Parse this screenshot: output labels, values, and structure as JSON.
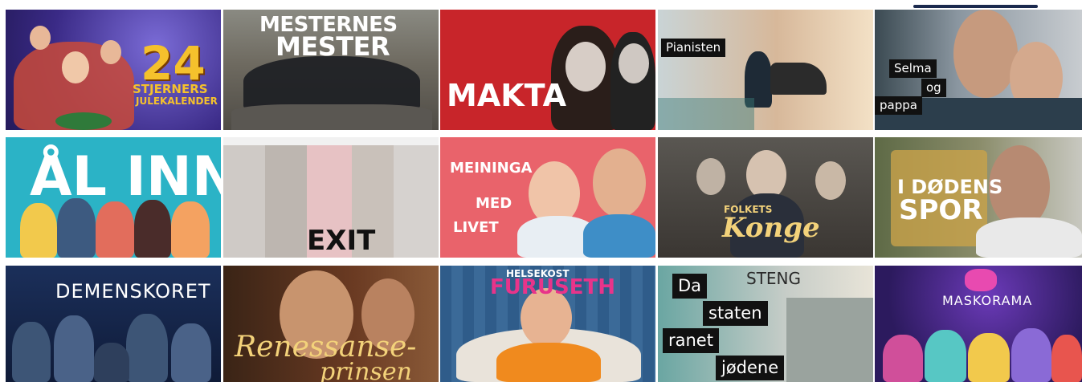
{
  "tiles": [
    {
      "id": "24-stjerners-julekalender",
      "title_main": "24",
      "title_sub1": "STJERNERS",
      "title_sub2": "JULEKALENDER"
    },
    {
      "id": "mesternes-mester",
      "line1": "MESTERNES",
      "line2": "MESTER"
    },
    {
      "id": "makta",
      "title": "MAKTA"
    },
    {
      "id": "pianisten",
      "label": "Pianisten"
    },
    {
      "id": "selma-og-pappa",
      "label1": "Selma",
      "label2": "og",
      "label3": "pappa"
    },
    {
      "id": "al-inn",
      "title": "ÅL INN"
    },
    {
      "id": "exit",
      "title": "EXIT"
    },
    {
      "id": "meininga-med-livet",
      "l1": "MEININGA",
      "l2": "MED",
      "l3": "LIVET"
    },
    {
      "id": "folkets-konge",
      "l1": "FOLKETS",
      "l2": "Konge"
    },
    {
      "id": "i-dodens-spor",
      "l1": "I DØDENS",
      "l2": "SPOR"
    },
    {
      "id": "demenskoret",
      "title": "DEMENSKORET"
    },
    {
      "id": "renessanseprinsen",
      "l1": "Renessanse-",
      "l2": "prinsen"
    },
    {
      "id": "helsekost-furuseth",
      "l1": "HELSEKOST",
      "l2": "FURUSETH"
    },
    {
      "id": "da-staten-ranet-jodene",
      "l1": "Da",
      "l2": "staten",
      "l3": "ranet",
      "l4": "jødene",
      "sign": "STENG"
    },
    {
      "id": "maskorama",
      "title": "MASKORAMA"
    }
  ]
}
